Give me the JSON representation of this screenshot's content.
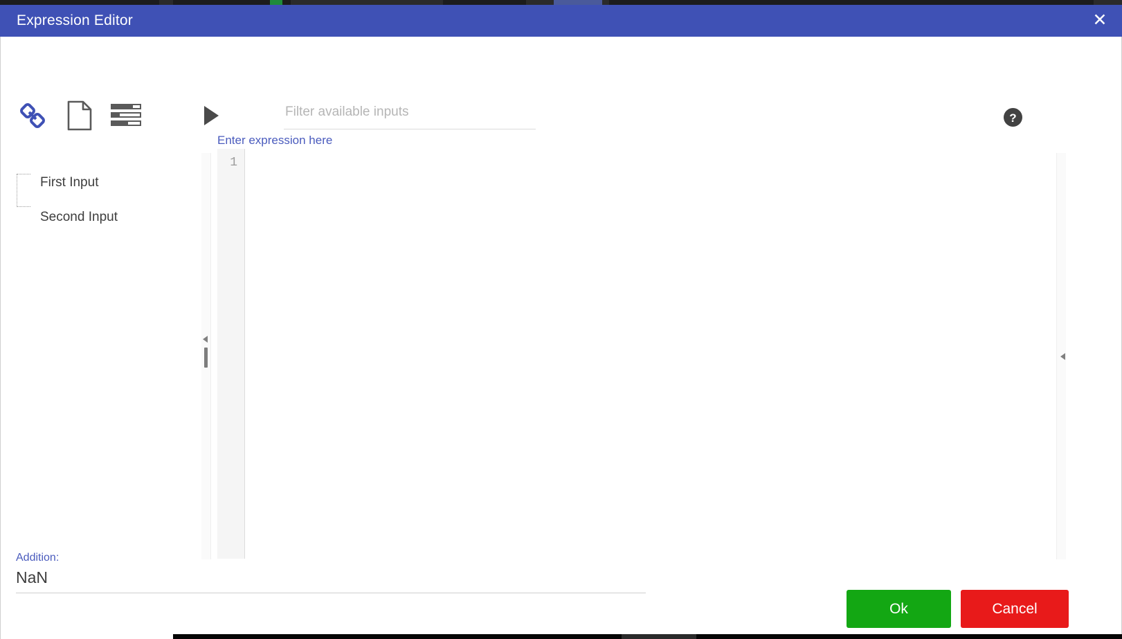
{
  "window": {
    "title": "Expression Editor",
    "close_label": "✕",
    "accent_color": "#3f51b5"
  },
  "toolbar": {
    "icons": [
      {
        "name": "link-icon",
        "tooltip": "Link",
        "color": "#3f51b5"
      },
      {
        "name": "document-icon",
        "tooltip": "Document",
        "color": "#5a5a5a"
      },
      {
        "name": "list-icon",
        "tooltip": "List",
        "color": "#5a5a5a"
      },
      {
        "name": "play-icon",
        "tooltip": "Run",
        "color": "#4a4a4a"
      }
    ],
    "filter": {
      "placeholder": "Filter available inputs",
      "value": ""
    },
    "help": {
      "name": "help-icon",
      "glyph": "?",
      "color": "#424242"
    }
  },
  "inputs_panel": {
    "items": [
      {
        "label": "First Input",
        "selected": true
      },
      {
        "label": "Second Input",
        "selected": false
      }
    ]
  },
  "splitters": {
    "left_collapse_glyph": "◀",
    "right_collapse_glyph": "◀"
  },
  "expression": {
    "label": "Enter expression here",
    "label_color": "#4a5bbd",
    "line_numbers": [
      "1"
    ],
    "value": "",
    "placeholder": ""
  },
  "result": {
    "label": "Addition:",
    "label_color": "#4a5bbd",
    "value": "NaN"
  },
  "buttons": {
    "ok": {
      "label": "Ok",
      "color": "#13a713"
    },
    "cancel": {
      "label": "Cancel",
      "color": "#e81a1a"
    }
  }
}
